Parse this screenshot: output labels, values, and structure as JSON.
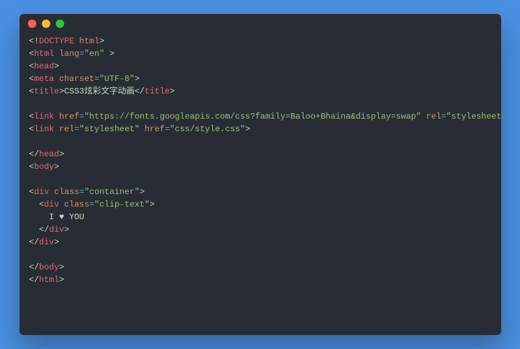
{
  "code": {
    "lines": [
      {
        "type": "line",
        "tokens": [
          {
            "c": "t-punct",
            "t": "<!"
          },
          {
            "c": "t-tag",
            "t": "DOCTYPE"
          },
          {
            "c": "t-punct",
            "t": " "
          },
          {
            "c": "t-attr",
            "t": "html"
          },
          {
            "c": "t-punct",
            "t": ">"
          }
        ]
      },
      {
        "type": "line",
        "tokens": [
          {
            "c": "t-punct",
            "t": "<"
          },
          {
            "c": "t-tag",
            "t": "html"
          },
          {
            "c": "t-punct",
            "t": " "
          },
          {
            "c": "t-attr",
            "t": "lang"
          },
          {
            "c": "t-op",
            "t": "="
          },
          {
            "c": "t-str",
            "t": "\"en\""
          },
          {
            "c": "t-punct",
            "t": " >"
          }
        ]
      },
      {
        "type": "line",
        "tokens": [
          {
            "c": "t-punct",
            "t": "<"
          },
          {
            "c": "t-tag",
            "t": "head"
          },
          {
            "c": "t-punct",
            "t": ">"
          }
        ]
      },
      {
        "type": "line",
        "tokens": [
          {
            "c": "t-punct",
            "t": "<"
          },
          {
            "c": "t-tag",
            "t": "meta"
          },
          {
            "c": "t-punct",
            "t": " "
          },
          {
            "c": "t-attr",
            "t": "charset"
          },
          {
            "c": "t-op",
            "t": "="
          },
          {
            "c": "t-str",
            "t": "\"UTF-8\""
          },
          {
            "c": "t-punct",
            "t": ">"
          }
        ]
      },
      {
        "type": "line",
        "tokens": [
          {
            "c": "t-punct",
            "t": "<"
          },
          {
            "c": "t-tag",
            "t": "title"
          },
          {
            "c": "t-punct",
            "t": ">"
          },
          {
            "c": "t-text",
            "t": "CSS3炫彩文字动画"
          },
          {
            "c": "t-punct",
            "t": "</"
          },
          {
            "c": "t-tag",
            "t": "title"
          },
          {
            "c": "t-punct",
            "t": ">"
          }
        ]
      },
      {
        "type": "blank"
      },
      {
        "type": "line",
        "tokens": [
          {
            "c": "t-punct",
            "t": "<"
          },
          {
            "c": "t-tag",
            "t": "link"
          },
          {
            "c": "t-punct",
            "t": " "
          },
          {
            "c": "t-attr",
            "t": "href"
          },
          {
            "c": "t-op",
            "t": "="
          },
          {
            "c": "t-str",
            "t": "\"https://fonts.googleapis.com/css?family=Baloo+Bhaina&display=swap\""
          },
          {
            "c": "t-punct",
            "t": " "
          },
          {
            "c": "t-attr",
            "t": "rel"
          },
          {
            "c": "t-op",
            "t": "="
          },
          {
            "c": "t-str",
            "t": "\"stylesheet\""
          },
          {
            "c": "t-punct",
            "t": ">"
          }
        ]
      },
      {
        "type": "line",
        "tokens": [
          {
            "c": "t-punct",
            "t": "<"
          },
          {
            "c": "t-tag",
            "t": "link"
          },
          {
            "c": "t-punct",
            "t": " "
          },
          {
            "c": "t-attr",
            "t": "rel"
          },
          {
            "c": "t-op",
            "t": "="
          },
          {
            "c": "t-str",
            "t": "\"stylesheet\""
          },
          {
            "c": "t-punct",
            "t": " "
          },
          {
            "c": "t-attr",
            "t": "href"
          },
          {
            "c": "t-op",
            "t": "="
          },
          {
            "c": "t-str",
            "t": "\"css/style.css\""
          },
          {
            "c": "t-punct",
            "t": ">"
          }
        ]
      },
      {
        "type": "blank"
      },
      {
        "type": "line",
        "tokens": [
          {
            "c": "t-punct",
            "t": "</"
          },
          {
            "c": "t-tag",
            "t": "head"
          },
          {
            "c": "t-punct",
            "t": ">"
          }
        ]
      },
      {
        "type": "line",
        "tokens": [
          {
            "c": "t-punct",
            "t": "<"
          },
          {
            "c": "t-tag",
            "t": "body"
          },
          {
            "c": "t-punct",
            "t": ">"
          }
        ]
      },
      {
        "type": "blank"
      },
      {
        "type": "line",
        "tokens": [
          {
            "c": "t-punct",
            "t": "<"
          },
          {
            "c": "t-tag",
            "t": "div"
          },
          {
            "c": "t-punct",
            "t": " "
          },
          {
            "c": "t-attr",
            "t": "class"
          },
          {
            "c": "t-op",
            "t": "="
          },
          {
            "c": "t-str",
            "t": "\"container\""
          },
          {
            "c": "t-punct",
            "t": ">"
          }
        ]
      },
      {
        "type": "line",
        "tokens": [
          {
            "c": "t-punct",
            "t": "  <"
          },
          {
            "c": "t-tag",
            "t": "div"
          },
          {
            "c": "t-punct",
            "t": " "
          },
          {
            "c": "t-attr",
            "t": "class"
          },
          {
            "c": "t-op",
            "t": "="
          },
          {
            "c": "t-str",
            "t": "\"clip-text\""
          },
          {
            "c": "t-punct",
            "t": ">"
          }
        ]
      },
      {
        "type": "line",
        "tokens": [
          {
            "c": "t-text",
            "t": "    I ♥ YOU"
          }
        ]
      },
      {
        "type": "line",
        "tokens": [
          {
            "c": "t-punct",
            "t": "  </"
          },
          {
            "c": "t-tag",
            "t": "div"
          },
          {
            "c": "t-punct",
            "t": ">"
          }
        ]
      },
      {
        "type": "line",
        "tokens": [
          {
            "c": "t-punct",
            "t": "</"
          },
          {
            "c": "t-tag",
            "t": "div"
          },
          {
            "c": "t-punct",
            "t": ">"
          }
        ]
      },
      {
        "type": "blank"
      },
      {
        "type": "line",
        "tokens": [
          {
            "c": "t-punct",
            "t": "</"
          },
          {
            "c": "t-tag",
            "t": "body"
          },
          {
            "c": "t-punct",
            "t": ">"
          }
        ]
      },
      {
        "type": "line",
        "tokens": [
          {
            "c": "t-punct",
            "t": "</"
          },
          {
            "c": "t-tag",
            "t": "html"
          },
          {
            "c": "t-punct",
            "t": ">"
          }
        ]
      }
    ]
  }
}
